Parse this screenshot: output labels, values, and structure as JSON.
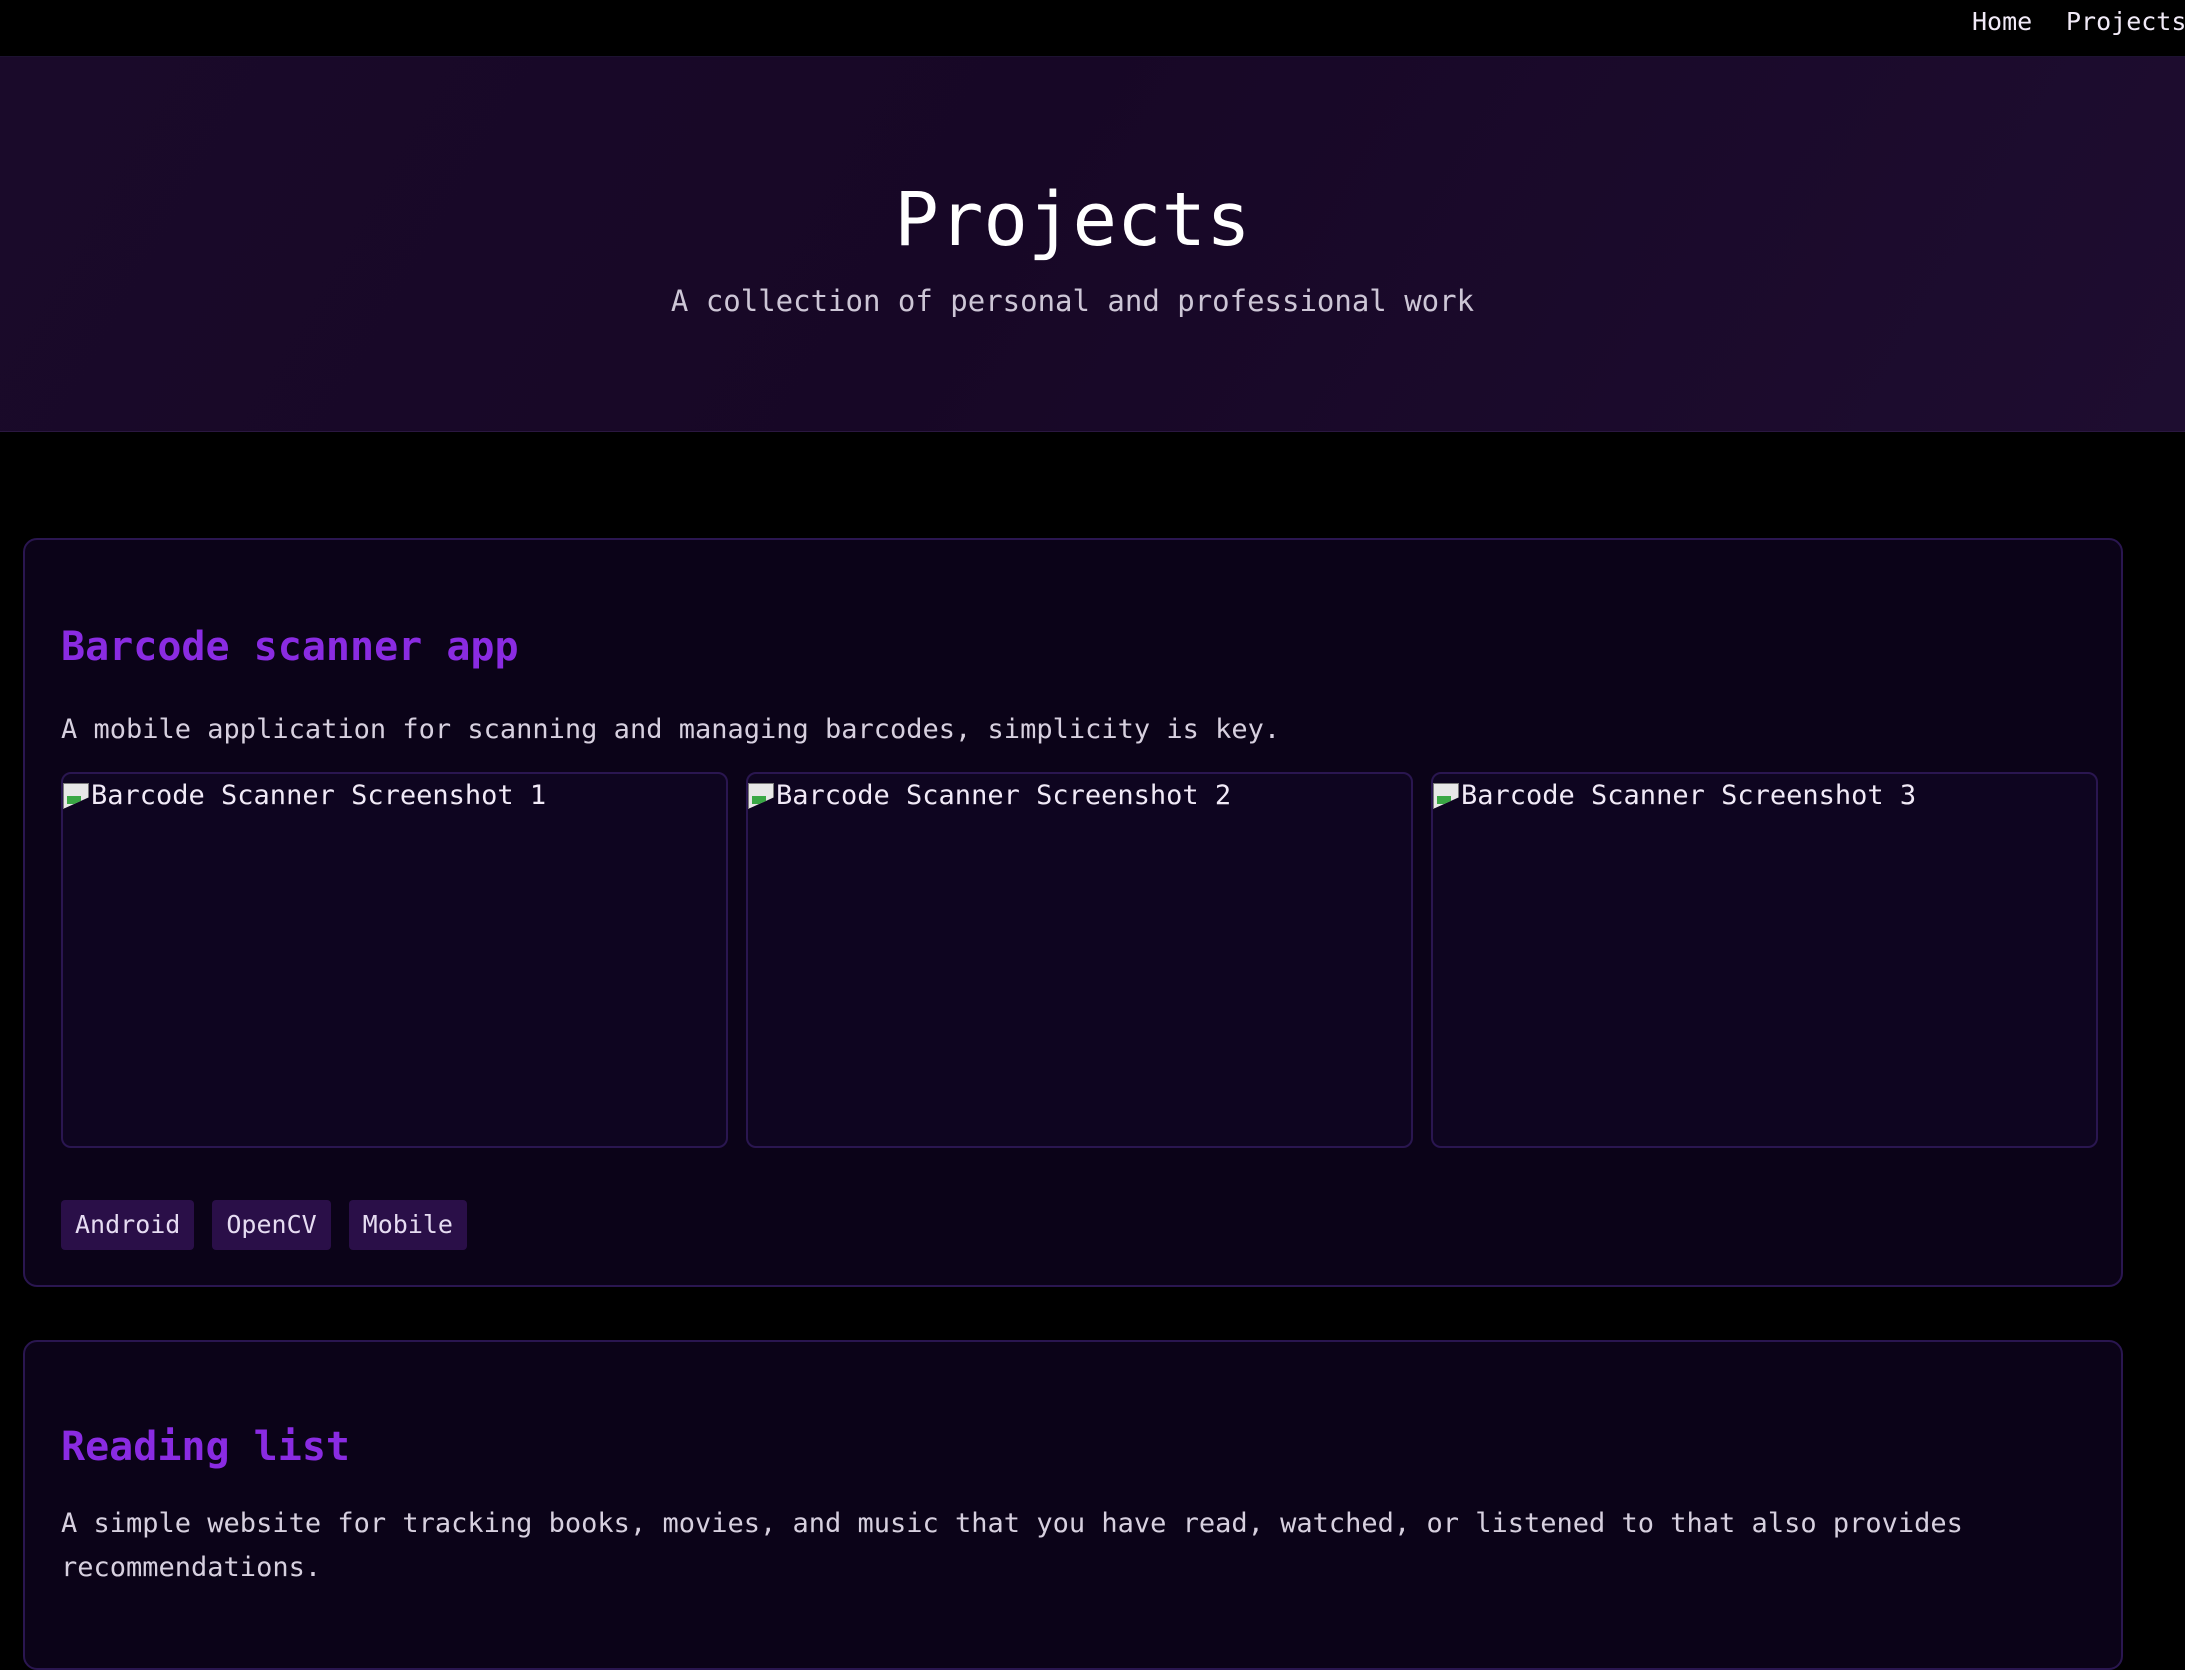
{
  "nav": {
    "links": [
      {
        "label": "Home"
      },
      {
        "label": "Projects"
      }
    ]
  },
  "hero": {
    "title": "Projects",
    "subtitle": "A collection of personal and professional work"
  },
  "projects": [
    {
      "title": "Barcode scanner app",
      "description": "A mobile application for scanning and managing barcodes, simplicity is key.",
      "screenshots": [
        {
          "alt": "Barcode Scanner Screenshot 1",
          "icon": "broken-image-icon"
        },
        {
          "alt": "Barcode Scanner Screenshot 2",
          "icon": "broken-image-icon"
        },
        {
          "alt": "Barcode Scanner Screenshot 3",
          "icon": "broken-image-icon"
        }
      ],
      "tags": [
        "Android",
        "OpenCV",
        "Mobile"
      ]
    },
    {
      "title": "Reading list",
      "description": "A simple website for tracking books, movies, and music that you have read, watched, or listened to that also provides recommendations."
    }
  ],
  "colors": {
    "background": "#000000",
    "hero_background": "#1a0a2a",
    "card_background": "#0b0318",
    "card_border": "#2a1650",
    "accent": "#8a2be2",
    "tag_background": "#2a0f48",
    "text": "#f1eaf7"
  }
}
